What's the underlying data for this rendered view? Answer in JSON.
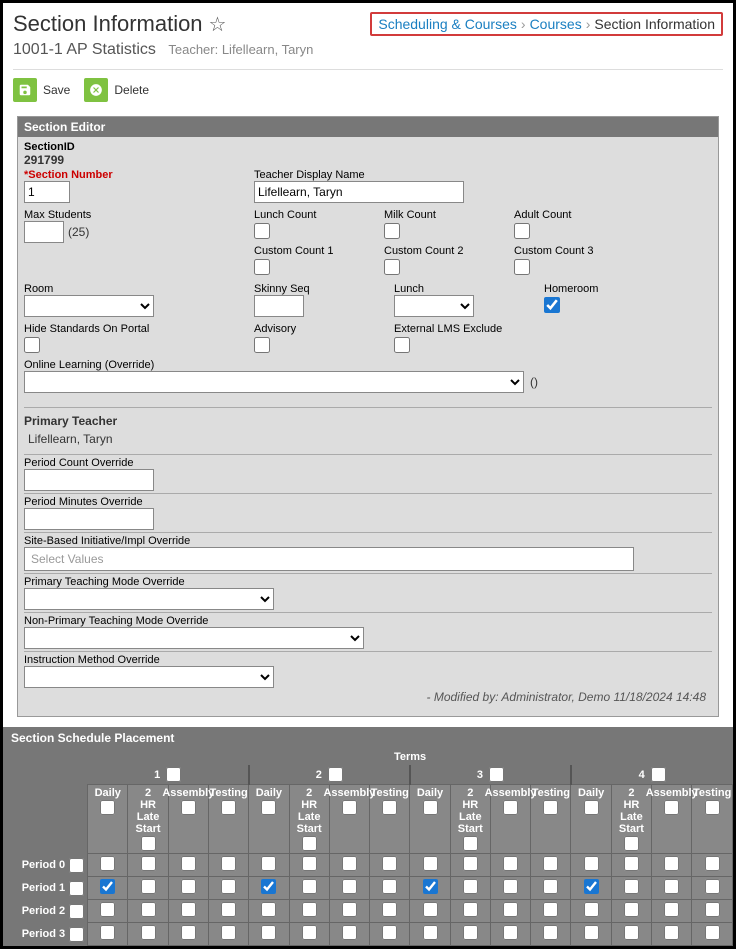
{
  "header": {
    "title": "Section Information",
    "breadcrumb": {
      "a": "Scheduling & Courses",
      "b": "Courses",
      "c": "Section Information"
    },
    "subtitle": "1001-1 AP Statistics",
    "teacher_lbl": "Teacher: Lifellearn, Taryn"
  },
  "toolbar": {
    "save": "Save",
    "delete": "Delete"
  },
  "editor": {
    "panelTitle": "Section Editor",
    "sectionIdLbl": "SectionID",
    "sectionId": "291799",
    "sectionNumLbl": "*Section Number",
    "sectionNum": "1",
    "maxStudentsLbl": "Max Students",
    "maxStudents": "",
    "maxStudentsParen": "(25)",
    "teacherDispLbl": "Teacher Display Name",
    "teacherDisp": "Lifellearn, Taryn",
    "lunchCountLbl": "Lunch Count",
    "milkCountLbl": "Milk Count",
    "adultCountLbl": "Adult Count",
    "cc1Lbl": "Custom Count 1",
    "cc2Lbl": "Custom Count 2",
    "cc3Lbl": "Custom Count 3",
    "roomLbl": "Room",
    "skinnyLbl": "Skinny Seq",
    "lunchLbl": "Lunch",
    "homeroomLbl": "Homeroom",
    "hideStdLbl": "Hide Standards On Portal",
    "advisoryLbl": "Advisory",
    "extLmsLbl": "External LMS Exclude",
    "onlineLbl": "Online Learning (Override)",
    "onlineParen": "()",
    "primTeachHdr": "Primary Teacher",
    "primTeach": "Lifellearn, Taryn",
    "pcoLbl": "Period Count Override",
    "pmoLbl": "Period Minutes Override",
    "sbiLbl": "Site-Based Initiative/Impl Override",
    "sbiPlaceholder": "Select Values",
    "ptmoLbl": "Primary Teaching Mode Override",
    "nptmoLbl": "Non-Primary Teaching Mode Override",
    "imoLbl": "Instruction Method Override",
    "modBy": "- Modified by: Administrator, Demo 11/18/2024 14:48"
  },
  "schedule": {
    "panelTitle": "Section Schedule Placement",
    "termsLbl": "Terms",
    "terms": [
      "1",
      "2",
      "3",
      "4"
    ],
    "cols": [
      "Daily",
      "2 HR Late Start",
      "Assembly",
      "Testing"
    ],
    "periods": [
      "Period 0",
      "Period 1",
      "Period 2",
      "Period 3"
    ],
    "checked": {
      "t1": {
        "Daily": {
          "Period 1": true
        }
      },
      "t2": {
        "Daily": {
          "Period 1": true
        }
      },
      "t3": {
        "Daily": {
          "Period 1": true
        }
      },
      "t4": {
        "Daily": {
          "Period 1": true
        }
      }
    }
  }
}
